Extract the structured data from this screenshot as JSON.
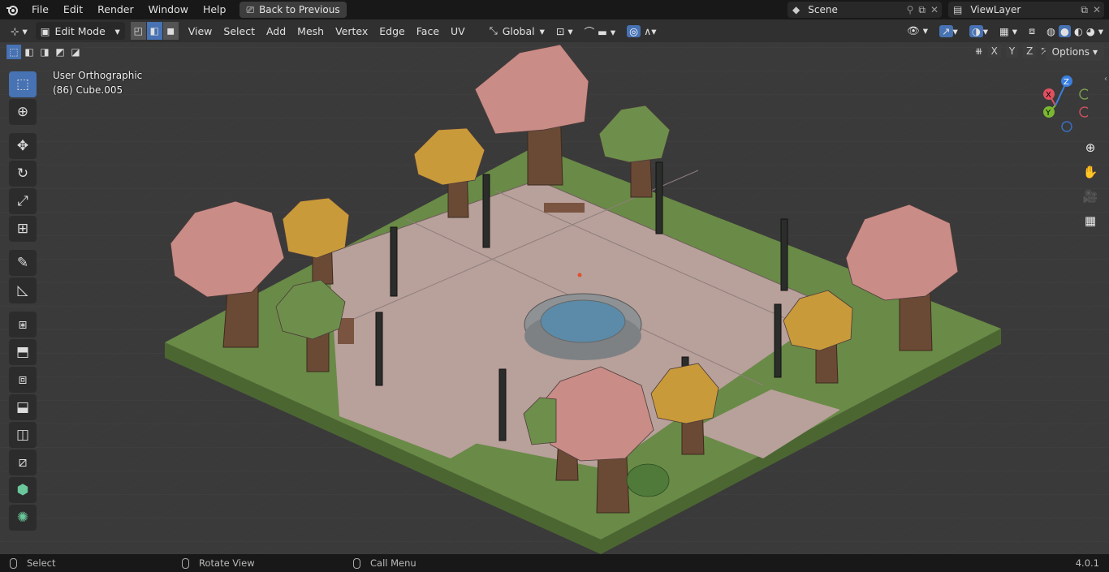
{
  "topbar": {
    "menus": [
      "File",
      "Edit",
      "Render",
      "Window",
      "Help"
    ],
    "back_button": "Back to Previous",
    "scene": "Scene",
    "view_layer": "ViewLayer"
  },
  "header": {
    "mode": "Edit Mode",
    "menus": [
      "View",
      "Select",
      "Add",
      "Mesh",
      "Vertex",
      "Edge",
      "Face",
      "UV"
    ],
    "transform_orientation": "Global",
    "options_label": "Options",
    "axis_x": "X",
    "axis_y": "Y",
    "axis_z": "Z"
  },
  "viewport": {
    "view_name": "User Orthographic",
    "object_info": "(86) Cube.005"
  },
  "gizmo": {
    "x": "X",
    "y": "Y",
    "z": "Z"
  },
  "statusbar": {
    "select": "Select",
    "rotate_view": "Rotate View",
    "call_menu": "Call Menu",
    "version": "4.0.1"
  },
  "colors": {
    "accent": "#4772b3",
    "grass": "#5f7f3f",
    "plaza": "#b69a94",
    "pink_tree": "#c98c86",
    "gold_tree": "#c99a3a",
    "green_tree": "#6e8f4c",
    "water": "#5b8ba8"
  }
}
